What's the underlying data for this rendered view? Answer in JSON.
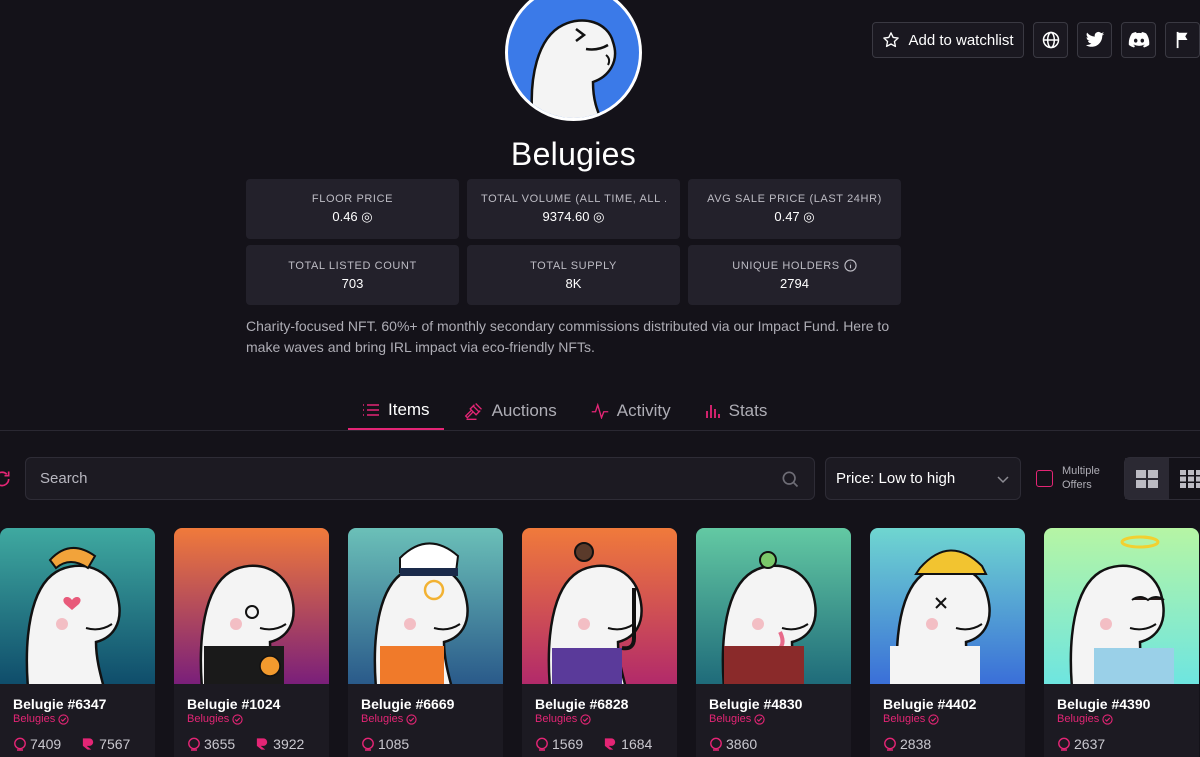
{
  "header": {
    "title": "Belugies",
    "watchlist_label": "Add to watchlist",
    "social_icons": [
      "globe-icon",
      "twitter-icon",
      "discord-icon",
      "flag-icon"
    ]
  },
  "stats": [
    {
      "label": "FLOOR PRICE",
      "value": "0.46 ◎"
    },
    {
      "label": "TOTAL VOLUME (ALL TIME, ALL ...",
      "value": "9374.60 ◎"
    },
    {
      "label": "AVG SALE PRICE (LAST 24HR)",
      "value": "0.47 ◎"
    },
    {
      "label": "TOTAL LISTED COUNT",
      "value": "703"
    },
    {
      "label": "TOTAL SUPPLY",
      "value": "8K"
    },
    {
      "label": "UNIQUE HOLDERS",
      "value": "2794"
    }
  ],
  "description": "Charity-focused NFT. 60%+ of monthly secondary commissions distributed via our Impact Fund. Here to make waves and bring IRL impact via eco-friendly NFTs.",
  "tabs": [
    {
      "label": "Items",
      "icon": "list-icon",
      "active": true
    },
    {
      "label": "Auctions",
      "icon": "gavel-icon",
      "active": false
    },
    {
      "label": "Activity",
      "icon": "activity-icon",
      "active": false
    },
    {
      "label": "Stats",
      "icon": "bar-chart-icon",
      "active": false
    }
  ],
  "filters": {
    "search_placeholder": "Search",
    "sort_value": "Price: Low to high",
    "multiple_offers_line1": "Multiple",
    "multiple_offers_line2": "Offers"
  },
  "colors": {
    "accent": "#e42575",
    "background": "#141219",
    "panel": "#23212b"
  },
  "cards": [
    {
      "name": "Belugie #6347",
      "collection": "Belugies",
      "price": "7409",
      "rank": "7567",
      "bg_top": "#3fa9a0",
      "bg_bottom": "#0f4d6b"
    },
    {
      "name": "Belugie #1024",
      "collection": "Belugies",
      "price": "3655",
      "rank": "3922",
      "bg_top": "#f07a3b",
      "bg_bottom": "#7a1f7a"
    },
    {
      "name": "Belugie #6669",
      "collection": "Belugies",
      "price": "1085",
      "rank": "",
      "bg_top": "#6bc0b8",
      "bg_bottom": "#2a5a8a"
    },
    {
      "name": "Belugie #6828",
      "collection": "Belugies",
      "price": "1569",
      "rank": "1684",
      "bg_top": "#f07a3b",
      "bg_bottom": "#b22a6a"
    },
    {
      "name": "Belugie #4830",
      "collection": "Belugies",
      "price": "3860",
      "rank": "",
      "bg_top": "#63c9a3",
      "bg_bottom": "#1f6b7a"
    },
    {
      "name": "Belugie #4402",
      "collection": "Belugies",
      "price": "2838",
      "rank": "",
      "bg_top": "#6fd6d0",
      "bg_bottom": "#3a6fd8"
    },
    {
      "name": "Belugie #4390",
      "collection": "Belugies",
      "price": "2637",
      "rank": "",
      "bg_top": "#b6f5a4",
      "bg_bottom": "#6ee5e0"
    }
  ]
}
